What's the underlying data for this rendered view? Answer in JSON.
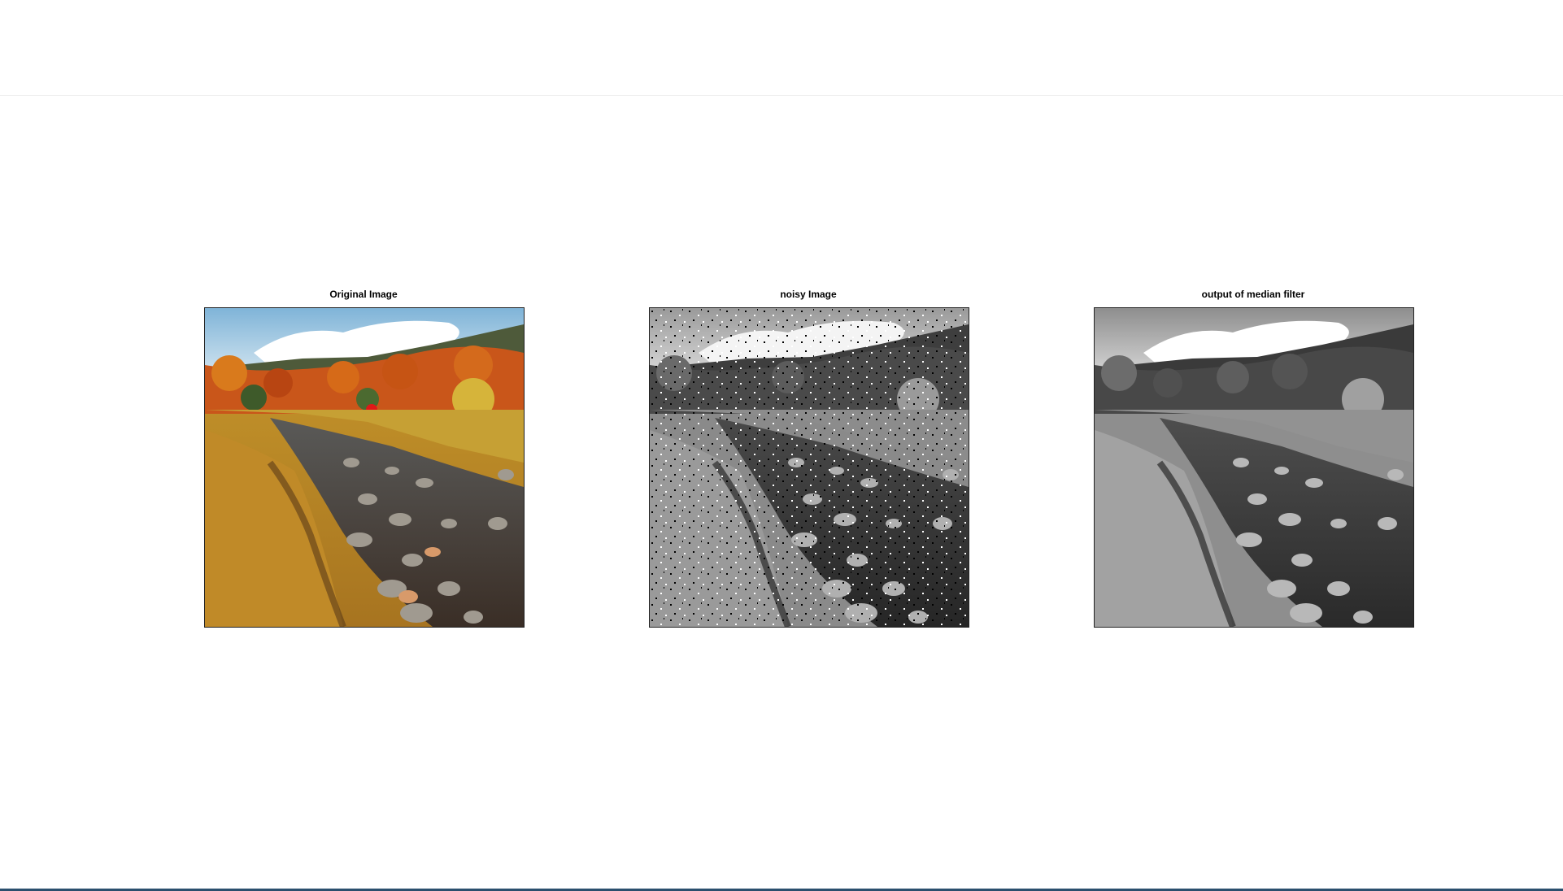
{
  "window": {
    "accent_color": "#2b4f6e"
  },
  "figure": {
    "panels": [
      {
        "title": "Original Image",
        "kind": "color-photo",
        "icon": "landscape-photo"
      },
      {
        "title": "noisy Image",
        "kind": "grayscale-salt-pepper",
        "icon": "landscape-photo"
      },
      {
        "title": "output of median filter",
        "kind": "grayscale-filtered",
        "icon": "landscape-photo"
      }
    ]
  }
}
